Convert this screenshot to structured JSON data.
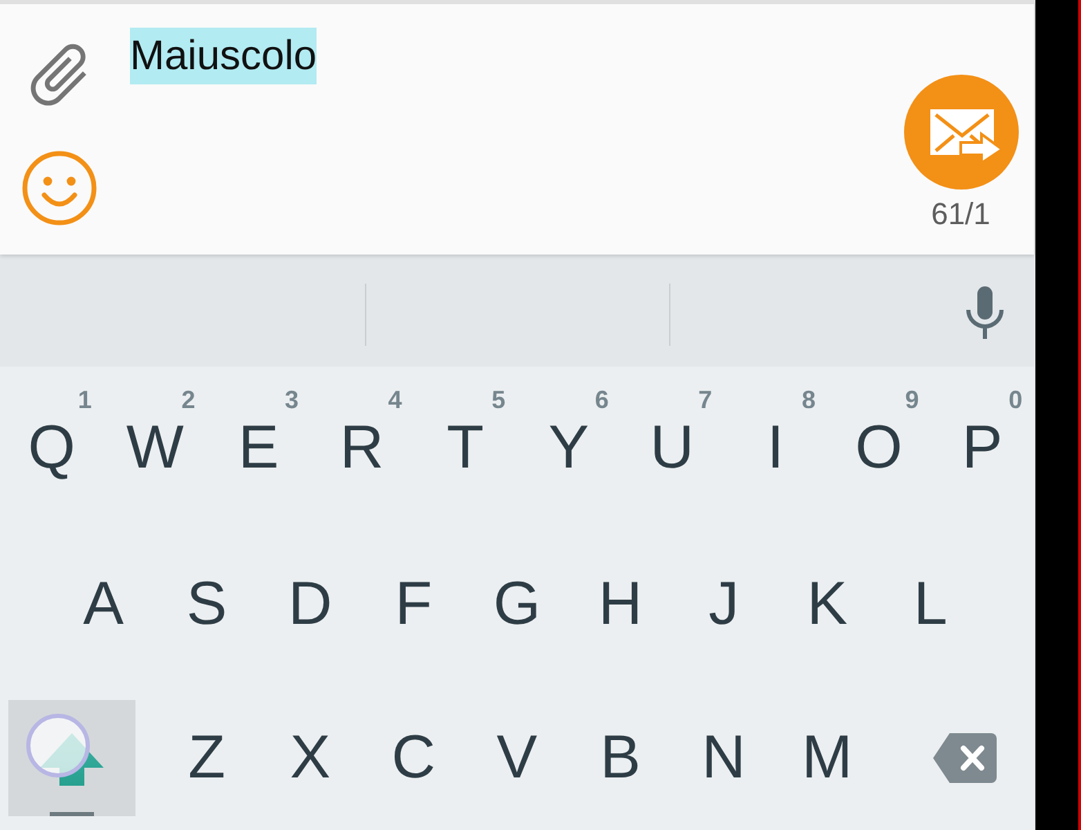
{
  "compose": {
    "message": {
      "value": "Maiuscolo",
      "selected": true
    },
    "counter": "61/1"
  },
  "keyboard": {
    "rows": [
      [
        {
          "kind": "letter",
          "label": "Q",
          "hint": "1"
        },
        {
          "kind": "letter",
          "label": "W",
          "hint": "2"
        },
        {
          "kind": "letter",
          "label": "E",
          "hint": "3"
        },
        {
          "kind": "letter",
          "label": "R",
          "hint": "4"
        },
        {
          "kind": "letter",
          "label": "T",
          "hint": "5"
        },
        {
          "kind": "letter",
          "label": "Y",
          "hint": "6"
        },
        {
          "kind": "letter",
          "label": "U",
          "hint": "7"
        },
        {
          "kind": "letter",
          "label": "I",
          "hint": "8"
        },
        {
          "kind": "letter",
          "label": "O",
          "hint": "9"
        },
        {
          "kind": "letter",
          "label": "P",
          "hint": "0"
        }
      ],
      [
        {
          "kind": "letter",
          "label": "A"
        },
        {
          "kind": "letter",
          "label": "S"
        },
        {
          "kind": "letter",
          "label": "D"
        },
        {
          "kind": "letter",
          "label": "F"
        },
        {
          "kind": "letter",
          "label": "G"
        },
        {
          "kind": "letter",
          "label": "H"
        },
        {
          "kind": "letter",
          "label": "J"
        },
        {
          "kind": "letter",
          "label": "K"
        },
        {
          "kind": "letter",
          "label": "L"
        }
      ],
      [
        {
          "kind": "shift",
          "active": true,
          "pressed": true,
          "caps_lock": true
        },
        {
          "kind": "letter",
          "label": "Z"
        },
        {
          "kind": "letter",
          "label": "X"
        },
        {
          "kind": "letter",
          "label": "C"
        },
        {
          "kind": "letter",
          "label": "V"
        },
        {
          "kind": "letter",
          "label": "B"
        },
        {
          "kind": "letter",
          "label": "N"
        },
        {
          "kind": "letter",
          "label": "M"
        },
        {
          "kind": "backspace"
        }
      ]
    ]
  }
}
